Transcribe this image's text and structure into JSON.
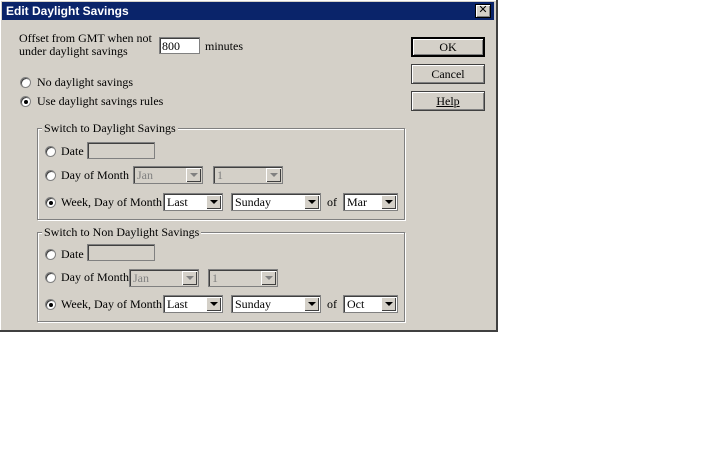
{
  "window": {
    "title": "Edit Daylight Savings"
  },
  "offset": {
    "label_line1": "Offset from GMT when not",
    "label_line2": "under daylight savings",
    "value": "800",
    "unit": "minutes"
  },
  "buttons": {
    "ok": "OK",
    "cancel": "Cancel",
    "help": "Help"
  },
  "mode": {
    "no_daylight": "No daylight savings",
    "use_rules": "Use daylight savings rules",
    "selected": "use_rules"
  },
  "to_dst": {
    "title": "Switch to Daylight Savings",
    "date_label": "Date",
    "dom_label": "Day of Month",
    "dom_month": "Jan",
    "dom_day": "1",
    "wdom_label": "Week, Day of Month",
    "week": "Last",
    "weekday": "Sunday",
    "of_label": "of",
    "month": "Mar",
    "selected": "week_day_of_month"
  },
  "to_std": {
    "title": "Switch to Non Daylight Savings",
    "date_label": "Date",
    "dom_label": "Day of Month",
    "dom_month": "Jan",
    "dom_day": "1",
    "wdom_label": "Week, Day of Month",
    "week": "Last",
    "weekday": "Sunday",
    "of_label": "of",
    "month": "Oct",
    "selected": "week_day_of_month"
  }
}
